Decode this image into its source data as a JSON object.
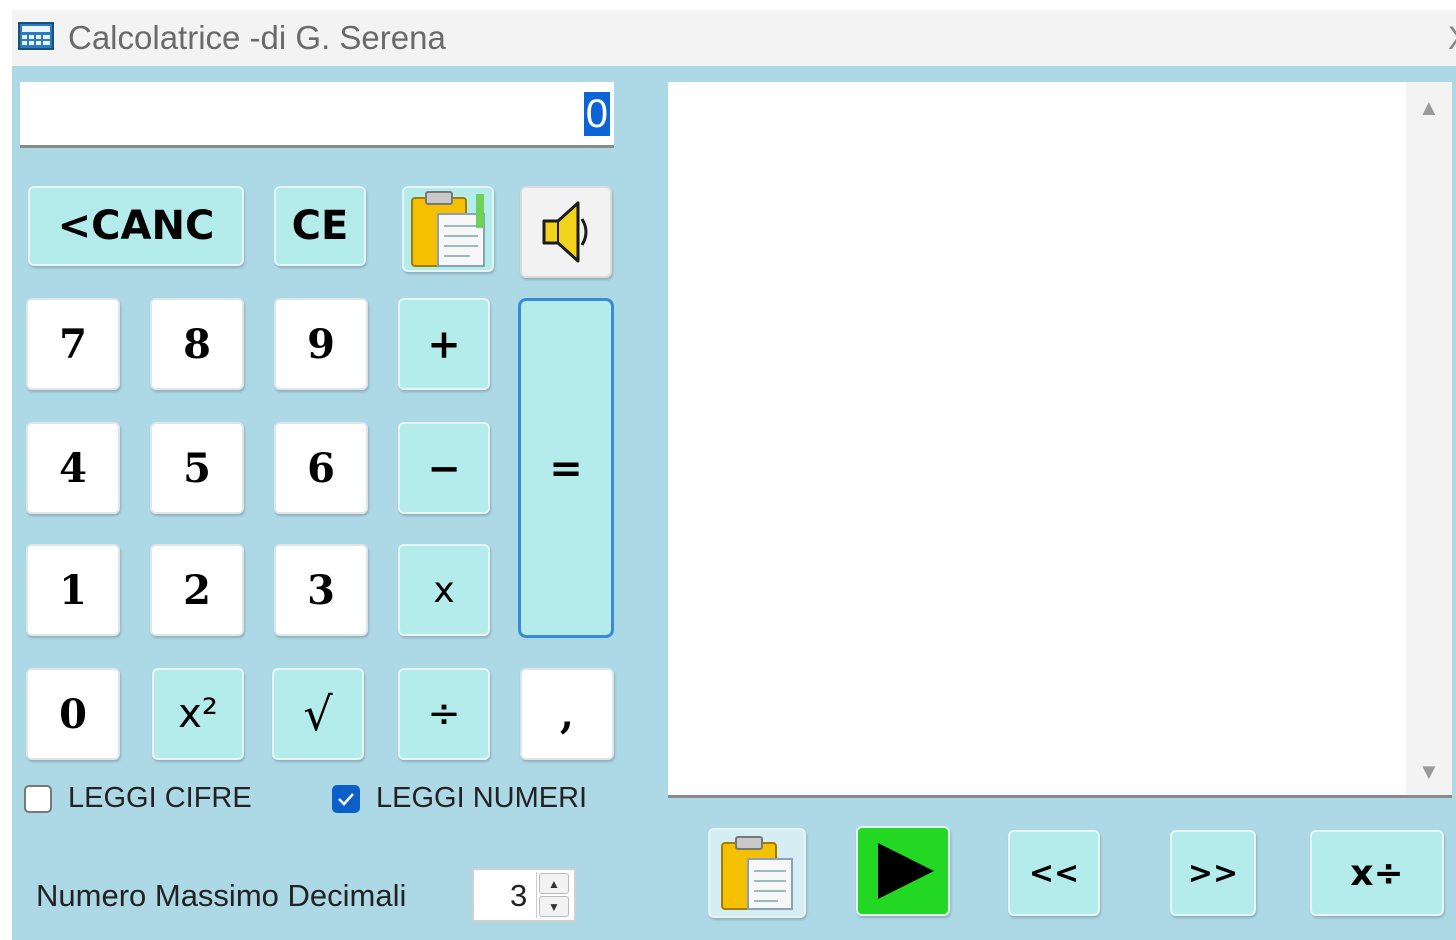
{
  "window": {
    "title": "Calcolatrice -di G. Serena",
    "app_icon": "calculator-icon",
    "close_glyph": "X"
  },
  "display": {
    "value": "0"
  },
  "keys": {
    "backspace": "<CANC",
    "clear_entry": "CE",
    "paste_icon": "clipboard-paste-icon",
    "speaker_icon": "speaker-icon",
    "seven": "7",
    "eight": "8",
    "nine": "9",
    "plus": "+",
    "four": "4",
    "five": "5",
    "six": "6",
    "minus": "−",
    "one": "1",
    "two": "2",
    "three": "3",
    "multiply": "x",
    "zero": "0",
    "square": "x²",
    "sqrt": "√",
    "divide": "÷",
    "comma": ",",
    "equals": "="
  },
  "options": {
    "read_digits": {
      "label": "LEGGI CIFRE",
      "checked": false
    },
    "read_numbers": {
      "label": "LEGGI NUMERI",
      "checked": true
    },
    "max_decimals": {
      "label": "Numero Massimo Decimali",
      "value": "3"
    }
  },
  "history_toolbar": {
    "paste_icon": "clipboard-paste-icon",
    "play_icon": "play-icon",
    "back": "<<",
    "forward": ">>",
    "ops": "x÷"
  }
}
